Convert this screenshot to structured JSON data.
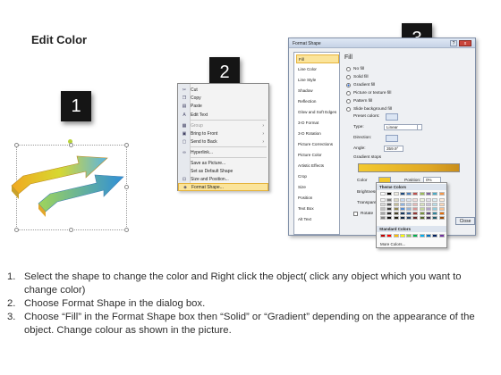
{
  "title": "Edit Color",
  "steps": [
    "1",
    "2",
    "3"
  ],
  "context_menu": {
    "items": [
      {
        "icon": "scissors-icon",
        "label": "Cut",
        "disabled": false,
        "arrow": ""
      },
      {
        "icon": "copy-icon",
        "label": "Copy",
        "disabled": false,
        "arrow": ""
      },
      {
        "icon": "paste-icon",
        "label": "Paste",
        "disabled": false,
        "arrow": ""
      },
      {
        "icon": "edit-text-icon",
        "label": "Edit Text",
        "disabled": false,
        "arrow": ""
      },
      {
        "icon": "group-icon",
        "label": "Group",
        "disabled": true,
        "arrow": "›"
      },
      {
        "icon": "bring-to-front-icon",
        "label": "Bring to Front",
        "disabled": false,
        "arrow": "›"
      },
      {
        "icon": "send-to-back-icon",
        "label": "Send to Back",
        "disabled": false,
        "arrow": "›"
      },
      {
        "icon": "hyperlink-icon",
        "label": "Hyperlink...",
        "disabled": false,
        "arrow": ""
      },
      {
        "icon": "save-picture-icon",
        "label": "Save as Picture...",
        "disabled": false,
        "arrow": ""
      },
      {
        "icon": "default-shape-icon",
        "label": "Set as Default Shape",
        "disabled": false,
        "arrow": ""
      },
      {
        "icon": "size-position-icon",
        "label": "Size and Position...",
        "disabled": false,
        "arrow": ""
      },
      {
        "icon": "format-shape-icon",
        "label": "Format Shape...",
        "disabled": false,
        "arrow": "",
        "highlighted": true
      }
    ]
  },
  "dialog": {
    "title": "Format Shape",
    "help": "?",
    "close_x": "x",
    "categories": [
      "Fill",
      "Line Color",
      "Line Style",
      "Shadow",
      "Reflection",
      "Glow and Soft Edges",
      "3-D Format",
      "3-D Rotation",
      "Picture Corrections",
      "Picture Color",
      "Artistic Effects",
      "Crop",
      "Size",
      "Position",
      "Text Box",
      "Alt Text"
    ],
    "selected_category": "Fill",
    "pane_title": "Fill",
    "fill_options": [
      "No fill",
      "Solid fill",
      "Gradient fill",
      "Picture or texture fill",
      "Pattern fill",
      "Slide background fill"
    ],
    "selected_fill": "Gradient fill",
    "preset_colors_label": "Preset colors:",
    "type_label": "Type:",
    "type_value": "Linear",
    "direction_label": "Direction:",
    "angle_label": "Angle:",
    "angle_value": "359.9°",
    "gradient_stops_label": "Gradient stops",
    "color_label": "Color",
    "position_label": "Position:",
    "position_value": "0%",
    "brightness_label": "Brightness",
    "transparency_label": "Transparen",
    "rotate_label": "Rotate",
    "close_label": "Close"
  },
  "palette": {
    "theme_header": "Theme Colors",
    "standard_header": "Standard Colors",
    "more_colors": "More Colors...",
    "top_row": [
      "#ffffff",
      "#000000",
      "#eeece1",
      "#1f497d",
      "#4f81bd",
      "#c0504d",
      "#9bbb59",
      "#8064a2",
      "#4bacc6",
      "#f79646"
    ],
    "shade_rows": [
      [
        "#f2f2f2",
        "#7f7f7f",
        "#ddd9c3",
        "#c6d9f0",
        "#dbe5f1",
        "#f2dcdb",
        "#ebf1dd",
        "#e5e0ec",
        "#dbeef3",
        "#fdeada"
      ],
      [
        "#d8d8d8",
        "#595959",
        "#c4bd97",
        "#8db3e2",
        "#b8cce4",
        "#e5b9b7",
        "#d7e3bc",
        "#ccc1d9",
        "#b7dde8",
        "#fbd5b5"
      ],
      [
        "#bfbfbf",
        "#3f3f3f",
        "#938953",
        "#548dd4",
        "#95b3d7",
        "#d99694",
        "#c3d69b",
        "#b2a2c7",
        "#92cddc",
        "#fac08f"
      ],
      [
        "#a5a5a5",
        "#262626",
        "#494429",
        "#17365d",
        "#366092",
        "#953734",
        "#76923c",
        "#5f497a",
        "#31859b",
        "#e36c09"
      ],
      [
        "#7f7f7f",
        "#0c0c0c",
        "#1d1b10",
        "#0f243e",
        "#244061",
        "#632423",
        "#4f6128",
        "#3f3151",
        "#205867",
        "#974806"
      ]
    ],
    "standard": [
      "#c00000",
      "#ff0000",
      "#ffc000",
      "#ffff00",
      "#92d050",
      "#00b050",
      "#00b0f0",
      "#0070c0",
      "#002060",
      "#7030a0"
    ]
  },
  "instructions": [
    {
      "num": "1.",
      "text": "Select the shape to change the color and Right click the object( click any object which you want to change color)"
    },
    {
      "num": "2.",
      "text": "Choose Format Shape in the dialog box."
    },
    {
      "num": "3.",
      "text": "Choose “Fill” in the Format Shape box then “Solid” or “Gradient” depending on the appearance of the object. Change colour as shown in the picture."
    }
  ]
}
